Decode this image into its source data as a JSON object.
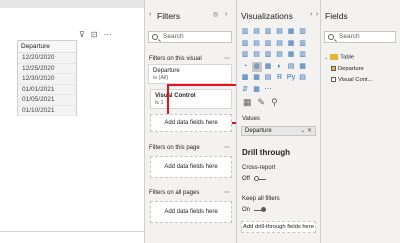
{
  "canvas": {
    "slicer": {
      "header": "Departure",
      "items": [
        "12/20/2020",
        "12/25/2020",
        "12/30/2020",
        "01/01/2021",
        "01/05/2021",
        "01/10/2021"
      ]
    },
    "visual_icons": [
      "filter-icon",
      "focus-mode-icon",
      "more-options-icon"
    ]
  },
  "filters_pane": {
    "title": "Filters",
    "search_placeholder": "Search",
    "on_this_visual": {
      "label": "Filters on this visual",
      "cards": [
        {
          "title": "Departure",
          "sub": "is (All)"
        },
        {
          "title": "Visual Control",
          "sub": "is 1"
        }
      ],
      "add_label": "Add data fields here"
    },
    "on_this_page": {
      "label": "Filters on this page",
      "add_label": "Add data fields here"
    },
    "on_all_pages": {
      "label": "Filters on all pages",
      "add_label": "Add data fields here"
    }
  },
  "visualizations_pane": {
    "title": "Visualizations",
    "gallery": [
      "▥",
      "▤",
      "▥",
      "▤",
      "▦",
      "▥",
      "▥",
      "▤",
      "▥",
      "▤",
      "▦",
      "▥",
      "▥",
      "▤",
      "▥",
      "▤",
      "▦",
      "▥",
      "◔",
      "◍",
      "▦",
      "◐",
      "▤",
      "▦",
      "▩",
      "▦",
      "▤",
      "R",
      "Py",
      "▤",
      "⇵",
      "▦",
      "⋯",
      "",
      "",
      ""
    ],
    "values_label": "Values",
    "values_chip": "Departure",
    "drill_through": {
      "title": "Drill through",
      "cross_report": {
        "label": "Cross-report",
        "state": "Off"
      },
      "keep_all_filters": {
        "label": "Keep all filters",
        "state": "On"
      },
      "add_label": "Add drill-through fields here"
    }
  },
  "fields_pane": {
    "title": "Fields",
    "search_placeholder": "Search",
    "table": "Table",
    "fields": [
      "Departure",
      "Visual Cont..."
    ]
  },
  "colors": {
    "highlight": "#e81123",
    "panel_bg": "#f3f2f1"
  }
}
